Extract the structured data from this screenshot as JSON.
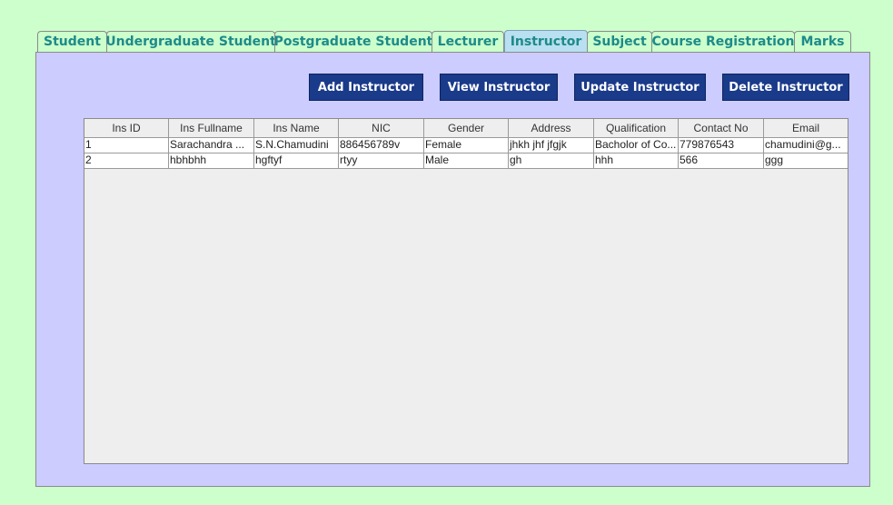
{
  "tabs": [
    {
      "label": "Student"
    },
    {
      "label": "Undergraduate Student"
    },
    {
      "label": "Postgraduate Student"
    },
    {
      "label": "Lecturer"
    },
    {
      "label": "Instructor"
    },
    {
      "label": "Subject"
    },
    {
      "label": "Course Registration"
    },
    {
      "label": "Marks"
    }
  ],
  "active_tab": "Instructor",
  "toolbar": {
    "add_label": "Add Instructor",
    "view_label": "View Instructor",
    "update_label": "Update Instructor",
    "delete_label": "Delete Instructor"
  },
  "table": {
    "columns": [
      "Ins ID",
      "Ins Fullname",
      "Ins Name",
      "NIC",
      "Gender",
      "Address",
      "Qualification",
      "Contact No",
      "Email"
    ],
    "rows": [
      [
        "1",
        "Sarachandra ...",
        "S.N.Chamudini",
        "886456789v",
        "Female",
        "jhkh  jhf jfgjk",
        "Bacholor of Co...",
        "779876543",
        "chamudini@g..."
      ],
      [
        "2",
        "hbhbhh",
        "hgftyf",
        "rtyy",
        "Male",
        "gh",
        "hhh",
        "566",
        "ggg"
      ]
    ]
  },
  "colors": {
    "background": "#ccffcc",
    "panel": "#ccccff",
    "tab_text": "#1e8a8a",
    "active_tab": "#b8e0f0",
    "button": "#1a3a8a"
  }
}
